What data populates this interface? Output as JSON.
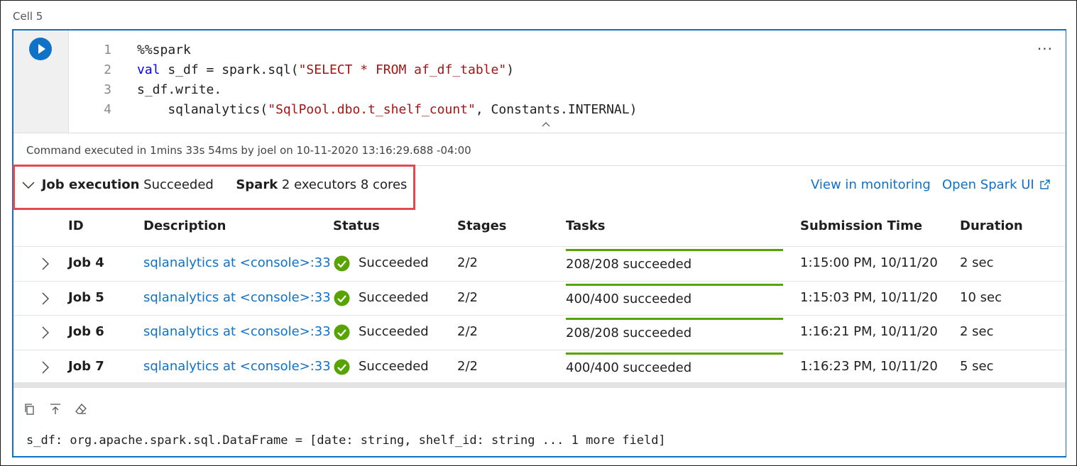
{
  "cell_label": "Cell 5",
  "code": {
    "lines": [
      {
        "n": "1",
        "parts": [
          {
            "t": "%%spark",
            "c": ""
          }
        ]
      },
      {
        "n": "2",
        "parts": [
          {
            "t": "val",
            "c": "kw"
          },
          {
            "t": " s_df = spark.sql(",
            "c": ""
          },
          {
            "t": "\"SELECT * FROM af_df_table\"",
            "c": "str"
          },
          {
            "t": ")",
            "c": ""
          }
        ]
      },
      {
        "n": "3",
        "parts": [
          {
            "t": "s_df.write.",
            "c": ""
          }
        ]
      },
      {
        "n": "4",
        "parts": [
          {
            "t": "    sqlanalytics(",
            "c": ""
          },
          {
            "t": "\"SqlPool.dbo.t_shelf_count\"",
            "c": "str"
          },
          {
            "t": ", Constants.INTERNAL)",
            "c": ""
          }
        ]
      }
    ],
    "more_label": "···"
  },
  "execution_info": "Command executed in 1mins 33s 54ms by joel on 10-11-2020 13:16:29.688 -04:00",
  "job_header": {
    "job_label": "Job execution",
    "job_status": "Succeeded",
    "spark_label": "Spark",
    "spark_info": "2 executors 8 cores",
    "view_monitoring": "View in monitoring",
    "open_spark_ui": "Open Spark UI"
  },
  "table": {
    "headers": {
      "id": "ID",
      "description": "Description",
      "status": "Status",
      "stages": "Stages",
      "tasks": "Tasks",
      "submission": "Submission Time",
      "duration": "Duration"
    },
    "rows": [
      {
        "id": "Job 4",
        "description": "sqlanalytics at <console>:33",
        "status": "Succeeded",
        "stages": "2/2",
        "tasks": "208/208 succeeded",
        "submission": "1:15:00 PM, 10/11/20",
        "duration": "2 sec"
      },
      {
        "id": "Job 5",
        "description": "sqlanalytics at <console>:33",
        "status": "Succeeded",
        "stages": "2/2",
        "tasks": "400/400 succeeded",
        "submission": "1:15:03 PM, 10/11/20",
        "duration": "10 sec"
      },
      {
        "id": "Job 6",
        "description": "sqlanalytics at <console>:33",
        "status": "Succeeded",
        "stages": "2/2",
        "tasks": "208/208 succeeded",
        "submission": "1:16:21 PM, 10/11/20",
        "duration": "2 sec"
      },
      {
        "id": "Job 7",
        "description": "sqlanalytics at <console>:33",
        "status": "Succeeded",
        "stages": "2/2",
        "tasks": "400/400 succeeded",
        "submission": "1:16:23 PM, 10/11/20",
        "duration": "5 sec"
      }
    ]
  },
  "output": "s_df: org.apache.spark.sql.DataFrame = [date: string, shelf_id: string ... 1 more field]",
  "colors": {
    "accent": "#0f72c7",
    "success": "#57a300",
    "highlight_box": "#e5484d"
  }
}
